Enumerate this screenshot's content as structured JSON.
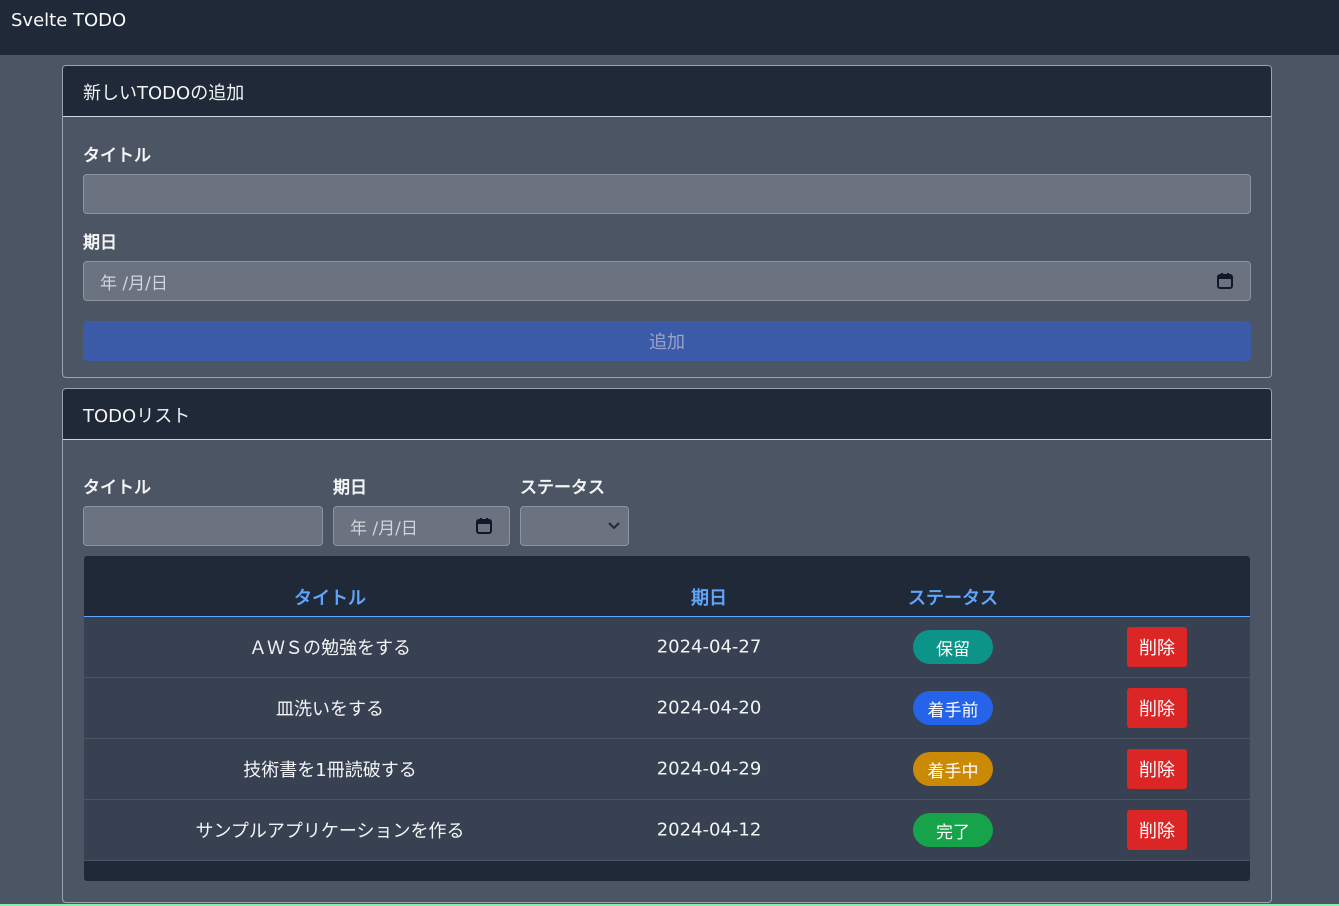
{
  "navbar": {
    "brand": "Svelte TODO"
  },
  "add_card": {
    "header": "新しいTODOの追加",
    "title_label": "タイトル",
    "title_value": "",
    "date_label": "期日",
    "date_placeholder": "年 /月/日",
    "add_button": "追加"
  },
  "list_card": {
    "header": "TODOリスト",
    "filters": {
      "title_label": "タイトル",
      "title_value": "",
      "date_label": "期日",
      "date_placeholder": "年 /月/日",
      "status_label": "ステータス",
      "status_value": ""
    },
    "table": {
      "columns": [
        "タイトル",
        "期日",
        "ステータス",
        ""
      ],
      "rows": [
        {
          "title": "ＡＷＳの勉強をする",
          "due": "2024-04-27",
          "status": "保留",
          "status_color": "#0d9488",
          "delete": "削除"
        },
        {
          "title": "皿洗いをする",
          "due": "2024-04-20",
          "status": "着手前",
          "status_color": "#2563eb",
          "delete": "削除"
        },
        {
          "title": "技術書を1冊読破する",
          "due": "2024-04-29",
          "status": "着手中",
          "status_color": "#ca8a04",
          "delete": "削除"
        },
        {
          "title": "サンプルアプリケーションを作る",
          "due": "2024-04-12",
          "status": "完了",
          "status_color": "#16a34a",
          "delete": "削除"
        }
      ]
    }
  },
  "icons": {
    "calendar": "calendar-icon",
    "select_arrow": "chevron-down-icon"
  }
}
